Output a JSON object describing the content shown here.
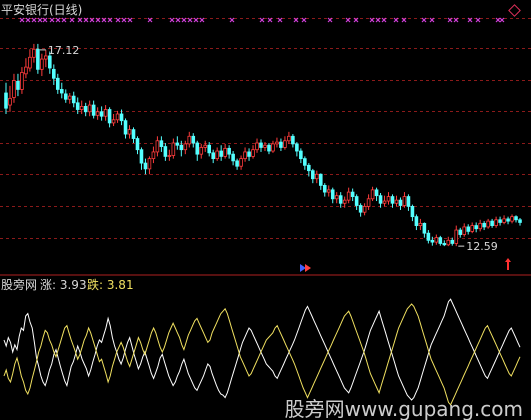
{
  "header": {
    "title": "平安银行(日线)"
  },
  "indicator": {
    "name": "股旁网",
    "rise_label": "涨: 3.93",
    "fall_label": "跌: 3.81"
  },
  "watermark": {
    "text": "股旁网www.gupang.com"
  },
  "colors": {
    "up": "#ff3c3c",
    "down": "#54ffff",
    "grid": "#8b1a1a",
    "line_a": "#ffffff",
    "line_b": "#f0e060",
    "marker": "#d040d8"
  },
  "chart_data": [
    {
      "type": "candlestick",
      "title": "平安银行(日线)",
      "ylim": [
        12.1,
        17.7
      ],
      "annotations": [
        {
          "text": "17.12",
          "index": 8,
          "value": 17.12
        },
        {
          "text": "12.59",
          "index": 113,
          "value": 12.59
        }
      ],
      "candles": [
        [
          16.02,
          15.68,
          16.25,
          15.55
        ],
        [
          15.75,
          15.9,
          16.18,
          15.6
        ],
        [
          15.92,
          16.3,
          16.45,
          15.8
        ],
        [
          16.28,
          16.1,
          16.45,
          15.95
        ],
        [
          16.1,
          16.48,
          16.6,
          16.0
        ],
        [
          16.45,
          16.6,
          16.8,
          16.35
        ],
        [
          16.58,
          16.82,
          17.0,
          16.5
        ],
        [
          16.82,
          17.0,
          17.12,
          16.7
        ],
        [
          17.0,
          16.55,
          17.12,
          16.45
        ],
        [
          16.55,
          16.78,
          16.9,
          16.4
        ],
        [
          16.78,
          16.85,
          16.98,
          16.6
        ],
        [
          16.85,
          16.58,
          16.95,
          16.45
        ],
        [
          16.55,
          16.35,
          16.66,
          16.2
        ],
        [
          16.35,
          16.1,
          16.45,
          16.0
        ],
        [
          16.1,
          16.02,
          16.25,
          15.9
        ],
        [
          16.0,
          15.88,
          16.1,
          15.8
        ],
        [
          15.88,
          15.95,
          16.02,
          15.78
        ],
        [
          15.95,
          15.8,
          16.05,
          15.7
        ],
        [
          15.8,
          15.65,
          15.92,
          15.55
        ],
        [
          15.65,
          15.72,
          15.85,
          15.55
        ],
        [
          15.72,
          15.6,
          15.8,
          15.5
        ],
        [
          15.6,
          15.75,
          15.85,
          15.5
        ],
        [
          15.75,
          15.52,
          15.85,
          15.45
        ],
        [
          15.52,
          15.6,
          15.7,
          15.42
        ],
        [
          15.6,
          15.5,
          15.72,
          15.4
        ],
        [
          15.5,
          15.65,
          15.75,
          15.4
        ],
        [
          15.65,
          15.35,
          15.7,
          15.25
        ],
        [
          15.35,
          15.42,
          15.55,
          15.28
        ],
        [
          15.42,
          15.55,
          15.62,
          15.35
        ],
        [
          15.55,
          15.4,
          15.65,
          15.3
        ],
        [
          15.4,
          15.1,
          15.45,
          15.0
        ],
        [
          15.1,
          15.2,
          15.3,
          15.0
        ],
        [
          15.2,
          15.0,
          15.25,
          14.9
        ],
        [
          15.0,
          14.75,
          15.05,
          14.65
        ],
        [
          14.75,
          14.45,
          14.8,
          14.3
        ],
        [
          14.45,
          14.32,
          14.55,
          14.2
        ],
        [
          14.32,
          14.55,
          14.6,
          14.2
        ],
        [
          14.55,
          14.7,
          14.82,
          14.45
        ],
        [
          14.7,
          14.95,
          15.05,
          14.6
        ],
        [
          14.95,
          14.82,
          15.05,
          14.7
        ],
        [
          14.82,
          14.6,
          14.9,
          14.5
        ],
        [
          14.6,
          14.62,
          14.75,
          14.5
        ],
        [
          14.62,
          14.9,
          15.0,
          14.55
        ],
        [
          14.9,
          14.85,
          15.05,
          14.75
        ],
        [
          14.85,
          14.75,
          14.95,
          14.6
        ],
        [
          14.75,
          14.88,
          14.95,
          14.65
        ],
        [
          14.88,
          15.05,
          15.15,
          14.8
        ],
        [
          15.05,
          14.9,
          15.12,
          14.8
        ],
        [
          14.9,
          14.65,
          14.95,
          14.5
        ],
        [
          14.65,
          14.8,
          14.88,
          14.55
        ],
        [
          14.8,
          14.85,
          14.95,
          14.7
        ],
        [
          14.85,
          14.68,
          14.92,
          14.6
        ],
        [
          14.68,
          14.55,
          14.75,
          14.45
        ],
        [
          14.55,
          14.72,
          14.8,
          14.5
        ],
        [
          14.72,
          14.6,
          14.85,
          14.5
        ],
        [
          14.6,
          14.78,
          14.88,
          14.55
        ],
        [
          14.78,
          14.65,
          14.85,
          14.55
        ],
        [
          14.65,
          14.5,
          14.72,
          14.4
        ],
        [
          14.5,
          14.38,
          14.55,
          14.3
        ],
        [
          14.38,
          14.55,
          14.62,
          14.3
        ],
        [
          14.55,
          14.7,
          14.8,
          14.48
        ],
        [
          14.7,
          14.6,
          14.78,
          14.5
        ],
        [
          14.6,
          14.75,
          14.85,
          14.55
        ],
        [
          14.75,
          14.9,
          15.0,
          14.68
        ],
        [
          14.9,
          14.8,
          14.98,
          14.7
        ],
        [
          14.8,
          14.85,
          14.92,
          14.72
        ],
        [
          14.85,
          14.72,
          14.9,
          14.65
        ],
        [
          14.72,
          14.88,
          14.95,
          14.68
        ],
        [
          14.88,
          14.92,
          15.02,
          14.8
        ],
        [
          14.92,
          14.8,
          15.0,
          14.72
        ],
        [
          14.8,
          14.95,
          15.05,
          14.75
        ],
        [
          14.95,
          15.05,
          15.15,
          14.88
        ],
        [
          15.05,
          14.88,
          15.1,
          14.8
        ],
        [
          14.88,
          14.72,
          14.92,
          14.6
        ],
        [
          14.72,
          14.55,
          14.78,
          14.45
        ],
        [
          14.55,
          14.4,
          14.6,
          14.3
        ],
        [
          14.4,
          14.28,
          14.45,
          14.15
        ],
        [
          14.28,
          14.1,
          14.32,
          14.0
        ],
        [
          14.1,
          14.2,
          14.28,
          14.0
        ],
        [
          14.2,
          13.95,
          14.22,
          13.85
        ],
        [
          13.95,
          13.8,
          14.0,
          13.7
        ],
        [
          13.8,
          13.85,
          13.95,
          13.7
        ],
        [
          13.85,
          13.65,
          13.9,
          13.55
        ],
        [
          13.65,
          13.72,
          13.8,
          13.55
        ],
        [
          13.72,
          13.55,
          13.8,
          13.45
        ],
        [
          13.55,
          13.62,
          13.7,
          13.45
        ],
        [
          13.62,
          13.8,
          13.9,
          13.55
        ],
        [
          13.8,
          13.7,
          13.88,
          13.6
        ],
        [
          13.7,
          13.5,
          13.75,
          13.4
        ],
        [
          13.5,
          13.35,
          13.55,
          13.25
        ],
        [
          13.35,
          13.48,
          13.55,
          13.28
        ],
        [
          13.48,
          13.65,
          13.75,
          13.4
        ],
        [
          13.65,
          13.85,
          13.92,
          13.6
        ],
        [
          13.85,
          13.72,
          13.9,
          13.6
        ],
        [
          13.72,
          13.55,
          13.78,
          13.45
        ],
        [
          13.55,
          13.6,
          13.72,
          13.48
        ],
        [
          13.6,
          13.7,
          13.8,
          13.52
        ],
        [
          13.7,
          13.55,
          13.75,
          13.45
        ],
        [
          13.55,
          13.62,
          13.72,
          13.48
        ],
        [
          13.62,
          13.5,
          13.68,
          13.4
        ],
        [
          13.5,
          13.7,
          13.8,
          13.45
        ],
        [
          13.7,
          13.48,
          13.75,
          13.38
        ],
        [
          13.48,
          13.25,
          13.52,
          13.15
        ],
        [
          13.25,
          13.05,
          13.3,
          12.95
        ],
        [
          13.05,
          13.1,
          13.2,
          12.95
        ],
        [
          13.1,
          12.88,
          13.12,
          12.78
        ],
        [
          12.88,
          12.72,
          12.95,
          12.65
        ],
        [
          12.72,
          12.68,
          12.8,
          12.6
        ],
        [
          12.68,
          12.78,
          12.85,
          12.62
        ],
        [
          12.78,
          12.65,
          12.82,
          12.6
        ],
        [
          12.65,
          12.62,
          12.72,
          12.59
        ],
        [
          12.62,
          12.72,
          12.8,
          12.59
        ],
        [
          12.72,
          12.65,
          12.78,
          12.6
        ],
        [
          12.65,
          12.95,
          13.05,
          12.59
        ],
        [
          12.95,
          12.85,
          13.0,
          12.78
        ],
        [
          12.85,
          13.02,
          13.1,
          12.8
        ],
        [
          13.02,
          12.92,
          13.08,
          12.85
        ],
        [
          12.92,
          13.05,
          13.12,
          12.88
        ],
        [
          13.05,
          12.98,
          13.12,
          12.9
        ],
        [
          12.98,
          13.1,
          13.18,
          12.92
        ],
        [
          13.1,
          13.02,
          13.15,
          12.95
        ],
        [
          13.02,
          13.15,
          13.2,
          12.98
        ],
        [
          13.15,
          13.05,
          13.2,
          13.0
        ],
        [
          13.05,
          13.18,
          13.25,
          13.0
        ],
        [
          13.18,
          13.12,
          13.25,
          13.05
        ],
        [
          13.12,
          13.2,
          13.28,
          13.08
        ],
        [
          13.2,
          13.15,
          13.25,
          13.08
        ],
        [
          13.15,
          13.25,
          13.3,
          13.1
        ],
        [
          13.25,
          13.18,
          13.28,
          13.12
        ],
        [
          13.18,
          13.12,
          13.22,
          13.05
        ]
      ]
    },
    {
      "type": "line",
      "title": "股旁网",
      "ylim": [
        0,
        100
      ],
      "series": [
        {
          "name": "涨",
          "values": [
            60,
            55,
            62,
            58,
            50,
            56,
            52,
            63,
            70,
            68,
            80,
            82,
            75,
            70,
            58,
            45,
            38,
            30,
            25,
            22,
            28,
            35,
            40,
            48,
            52,
            45,
            38,
            32,
            26,
            22,
            30,
            38,
            42,
            48,
            55,
            50,
            44,
            40,
            36,
            30,
            35,
            42,
            48,
            55,
            60,
            58,
            64,
            70,
            78,
            72,
            62,
            55,
            50,
            44,
            40,
            45,
            52,
            58,
            62,
            55,
            48,
            42,
            36,
            40,
            46,
            50,
            44,
            38,
            32,
            28,
            33,
            38,
            45,
            48,
            42,
            36,
            30,
            26,
            22,
            25,
            30,
            34,
            40,
            44,
            38,
            32,
            28,
            24,
            20,
            18,
            22,
            26,
            30,
            35,
            40,
            38,
            32,
            27,
            22,
            18,
            15,
            14,
            12,
            16,
            22,
            28,
            34,
            40,
            46,
            52,
            58,
            62,
            66,
            70,
            68,
            64,
            60,
            56,
            52,
            48,
            44,
            40,
            38,
            36,
            34,
            30,
            28,
            32,
            36,
            40,
            44,
            48,
            52,
            56,
            60,
            65,
            70,
            75,
            80,
            85,
            88,
            84,
            80,
            76,
            72,
            68,
            64,
            60,
            56,
            52,
            48,
            44,
            40,
            36,
            32,
            28,
            24,
            20,
            18,
            16,
            20,
            25,
            30,
            35,
            40,
            45,
            50,
            56,
            62,
            68,
            72,
            76,
            80,
            84,
            78,
            72,
            66,
            60,
            54,
            48,
            42,
            36,
            30,
            26,
            22,
            18,
            14,
            12,
            10,
            12,
            16,
            20,
            26,
            32,
            38,
            44,
            50,
            56,
            60,
            64,
            68,
            72,
            76,
            80,
            86,
            92,
            94,
            90,
            86,
            82,
            78,
            74,
            70,
            66,
            62,
            58,
            54,
            50,
            46,
            42,
            38,
            34,
            30,
            28,
            32,
            36,
            40,
            44,
            48,
            52,
            56,
            60,
            64,
            68,
            70,
            66,
            62,
            58,
            54
          ]
        },
        {
          "name": "跌",
          "values": [
            30,
            35,
            28,
            25,
            32,
            40,
            45,
            38,
            30,
            25,
            18,
            15,
            20,
            28,
            35,
            42,
            50,
            55,
            62,
            68,
            66,
            60,
            56,
            50,
            46,
            52,
            58,
            64,
            70,
            72,
            66,
            60,
            55,
            50,
            44,
            48,
            54,
            60,
            64,
            70,
            66,
            60,
            54,
            48,
            42,
            44,
            38,
            32,
            25,
            30,
            38,
            44,
            50,
            54,
            58,
            54,
            48,
            42,
            38,
            44,
            50,
            56,
            62,
            58,
            52,
            48,
            54,
            60,
            66,
            70,
            66,
            60,
            54,
            50,
            54,
            60,
            66,
            70,
            74,
            70,
            66,
            62,
            56,
            52,
            58,
            64,
            68,
            72,
            76,
            78,
            74,
            70,
            66,
            62,
            58,
            60,
            66,
            70,
            74,
            78,
            82,
            84,
            86,
            82,
            76,
            70,
            64,
            58,
            52,
            46,
            42,
            38,
            34,
            30,
            32,
            36,
            40,
            44,
            48,
            52,
            56,
            60,
            62,
            64,
            66,
            70,
            72,
            68,
            64,
            60,
            56,
            52,
            48,
            44,
            40,
            35,
            30,
            25,
            20,
            16,
            12,
            16,
            20,
            24,
            28,
            32,
            36,
            40,
            44,
            48,
            52,
            56,
            60,
            64,
            68,
            72,
            76,
            80,
            82,
            84,
            80,
            75,
            70,
            65,
            60,
            55,
            50,
            44,
            38,
            32,
            28,
            24,
            20,
            16,
            22,
            28,
            34,
            40,
            46,
            52,
            58,
            64,
            70,
            74,
            78,
            82,
            86,
            88,
            90,
            88,
            84,
            80,
            74,
            68,
            62,
            56,
            50,
            44,
            40,
            36,
            32,
            28,
            24,
            20,
            14,
            8,
            6,
            10,
            14,
            18,
            22,
            26,
            30,
            34,
            38,
            42,
            46,
            50,
            54,
            58,
            62,
            66,
            70,
            72,
            68,
            64,
            60,
            56,
            52,
            48,
            44,
            40,
            36,
            32,
            30,
            34,
            38,
            42,
            46
          ]
        }
      ]
    }
  ]
}
